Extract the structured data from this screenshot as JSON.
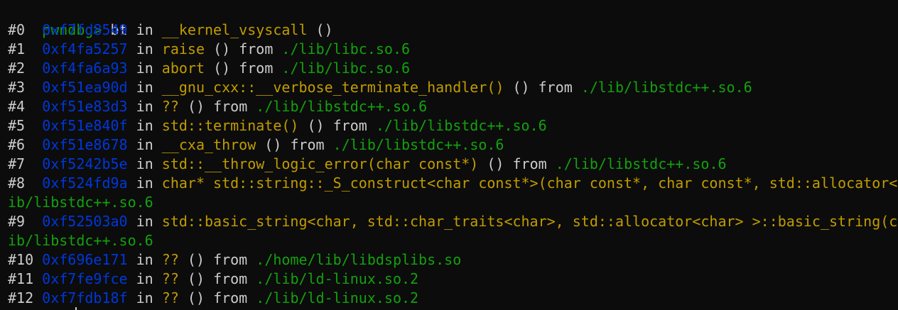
{
  "colors": {
    "background": "#0c0c0c",
    "default_text": "#cccccc",
    "prompt": "#13a10e",
    "address": "#0037da",
    "function": "#c19c00",
    "library": "#13a10e"
  },
  "prompt": {
    "label": "pwndbg>",
    "command": "bt"
  },
  "keywords": {
    "in": "in",
    "from": "from"
  },
  "frames": [
    {
      "num": "#0",
      "addr": "0xf7fd8549",
      "func": "__kernel_vsyscall",
      "args": "()",
      "lib": ""
    },
    {
      "num": "#1",
      "addr": "0xf4fa5257",
      "func": "raise",
      "args": "()",
      "lib": "./lib/libc.so.6"
    },
    {
      "num": "#2",
      "addr": "0xf4fa6a93",
      "func": "abort",
      "args": "()",
      "lib": "./lib/libc.so.6"
    },
    {
      "num": "#3",
      "addr": "0xf51ea90d",
      "func": "__gnu_cxx::__verbose_terminate_handler()",
      "args": "()",
      "lib": "./lib/libstdc++.so.6"
    },
    {
      "num": "#4",
      "addr": "0xf51e83d3",
      "func": "??",
      "args": "()",
      "lib": "./lib/libstdc++.so.6"
    },
    {
      "num": "#5",
      "addr": "0xf51e840f",
      "func": "std::terminate()",
      "args": "()",
      "lib": "./lib/libstdc++.so.6"
    },
    {
      "num": "#6",
      "addr": "0xf51e8678",
      "func": "__cxa_throw",
      "args": "()",
      "lib": "./lib/libstdc++.so.6"
    },
    {
      "num": "#7",
      "addr": "0xf5242b5e",
      "func": "std::__throw_logic_error(char const*)",
      "args": "()",
      "lib": "./lib/libstdc++.so.6"
    },
    {
      "num": "#8",
      "addr": "0xf524fd9a",
      "func": "char* std::string::_S_construct<char const*>(char const*, char const*, std::allocator<c",
      "args": "",
      "lib": "",
      "wrap": "ib/libstdc++.so.6"
    },
    {
      "num": "#9",
      "addr": "0xf52503a0",
      "func": "std::basic_string<char, std::char_traits<char>, std::allocator<char> >::basic_string(ch",
      "args": "",
      "lib": "",
      "wrap": "ib/libstdc++.so.6"
    },
    {
      "num": "#10",
      "addr": "0xf696e171",
      "func": "??",
      "args": "()",
      "lib": "./home/lib/libdsplibs.so"
    },
    {
      "num": "#11",
      "addr": "0xf7fe9fce",
      "func": "??",
      "args": "()",
      "lib": "./lib/ld-linux.so.2"
    },
    {
      "num": "#12",
      "addr": "0xf7fdb18f",
      "func": "??",
      "args": "()",
      "lib": "./lib/ld-linux.so.2"
    }
  ]
}
